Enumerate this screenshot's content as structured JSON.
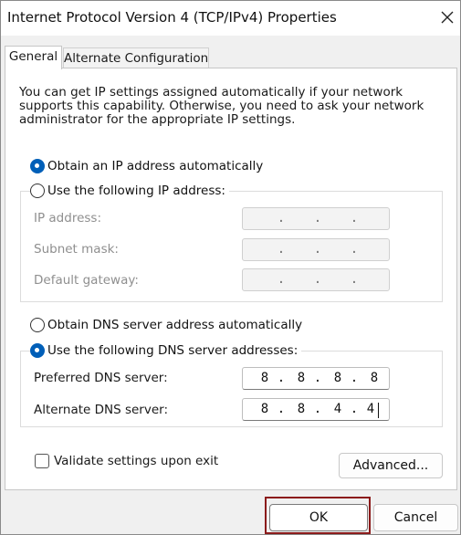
{
  "window": {
    "title": "Internet Protocol Version 4 (TCP/IPv4) Properties"
  },
  "tabs": [
    {
      "label": "General",
      "active": true
    },
    {
      "label": "Alternate Configuration",
      "active": false
    }
  ],
  "intro_text": "You can get IP settings assigned automatically if your network supports this capability. Otherwise, you need to ask your network administrator for the appropriate IP settings.",
  "ip_section": {
    "auto_label": "Obtain an IP address automatically",
    "auto_selected": true,
    "manual_label": "Use the following IP address:",
    "manual_selected": false,
    "fields": [
      {
        "label": "IP address:",
        "value": [
          "",
          "",
          "",
          ""
        ],
        "enabled": false
      },
      {
        "label": "Subnet mask:",
        "value": [
          "",
          "",
          "",
          ""
        ],
        "enabled": false
      },
      {
        "label": "Default gateway:",
        "value": [
          "",
          "",
          "",
          ""
        ],
        "enabled": false
      }
    ]
  },
  "dns_section": {
    "auto_label": "Obtain DNS server address automatically",
    "auto_selected": false,
    "manual_label": "Use the following DNS server addresses:",
    "manual_selected": true,
    "preferred": {
      "label": "Preferred DNS server:",
      "octets": [
        "8",
        "8",
        "8",
        "8"
      ]
    },
    "alternate": {
      "label": "Alternate DNS server:",
      "octets": [
        "8",
        "8",
        "4",
        "4"
      ]
    }
  },
  "validate": {
    "label": "Validate settings upon exit",
    "checked": false
  },
  "buttons": {
    "advanced": "Advanced...",
    "ok": "OK",
    "cancel": "Cancel"
  },
  "colors": {
    "accent": "#005fb8",
    "highlight_frame": "#8b1b1b"
  },
  "icons": {
    "close": "close-icon"
  }
}
